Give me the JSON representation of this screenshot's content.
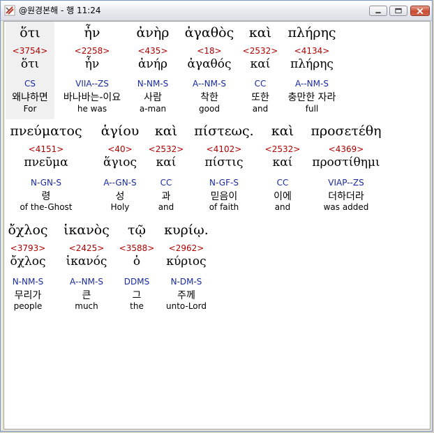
{
  "window": {
    "title": "@원경본해 - 행 11:24",
    "buttons": {
      "minimize": "minimize",
      "maximize": "maximize",
      "close": "close"
    }
  },
  "lines": [
    {
      "words": [
        {
          "greek": "ὅτι",
          "strongs": "<3754>",
          "lemma": "ὅτι",
          "parse": "CS",
          "korean": "왜냐하면",
          "english": "For"
        },
        {
          "greek": "ἦν",
          "strongs": "<2258>",
          "lemma": "ἦν",
          "parse": "VIIA--ZS",
          "korean": "바나바는-이요",
          "english": "he was"
        },
        {
          "greek": "ἀνὴρ",
          "strongs": "<435>",
          "lemma": "ἀνήρ",
          "parse": "N-NM-S",
          "korean": "사람",
          "english": "a-man"
        },
        {
          "greek": "ἀγαθὸς",
          "strongs": "<18>",
          "lemma": "ἀγαθός",
          "parse": "A--NM-S",
          "korean": "착한",
          "english": "good"
        },
        {
          "greek": "καὶ",
          "strongs": "<2532>",
          "lemma": "καί",
          "parse": "CC",
          "korean": "또한",
          "english": "and"
        },
        {
          "greek": "πλήρης",
          "strongs": "<4134>",
          "lemma": "πλήρης",
          "parse": "A--NM-S",
          "korean": "충만한 자라",
          "english": "full"
        }
      ]
    },
    {
      "words": [
        {
          "greek": "πνεύματος",
          "strongs": "<4151>",
          "lemma": "πνεῦμα",
          "parse": "N-GN-S",
          "korean": "령",
          "english": "of the-Ghost"
        },
        {
          "greek": "ἁγίου",
          "strongs": "<40>",
          "lemma": "ἅγιος",
          "parse": "A--GN-S",
          "korean": "성",
          "english": "Holy"
        },
        {
          "greek": "καὶ",
          "strongs": "<2532>",
          "lemma": "καί",
          "parse": "CC",
          "korean": "과",
          "english": "and"
        },
        {
          "greek": "πίστεως.",
          "strongs": "<4102>",
          "lemma": "πίστις",
          "parse": "N-GF-S",
          "korean": "믿음이",
          "english": "of faith"
        },
        {
          "greek": "καὶ",
          "strongs": "<2532>",
          "lemma": "καί",
          "parse": "CC",
          "korean": "이에",
          "english": "and"
        },
        {
          "greek": "προσετέθη",
          "strongs": "<4369>",
          "lemma": "προστίθημι",
          "parse": "VIAP--ZS",
          "korean": "더하더라",
          "english": "was added"
        }
      ]
    },
    {
      "words": [
        {
          "greek": "ὄχλος",
          "strongs": "<3793>",
          "lemma": "ὄχλος",
          "parse": "N-NM-S",
          "korean": "무리가",
          "english": "people"
        },
        {
          "greek": "ἱκανὸς",
          "strongs": "<2425>",
          "lemma": "ἱκανός",
          "parse": "A--NM-S",
          "korean": "큰",
          "english": "much"
        },
        {
          "greek": "τῷ",
          "strongs": "<3588>",
          "lemma": "ὁ",
          "parse": "DDMS",
          "korean": "그",
          "english": "the"
        },
        {
          "greek": "κυρίῳ.",
          "strongs": "<2962>",
          "lemma": "κύριος",
          "parse": "N-DM-S",
          "korean": "주께",
          "english": "unto-Lord"
        }
      ]
    }
  ]
}
